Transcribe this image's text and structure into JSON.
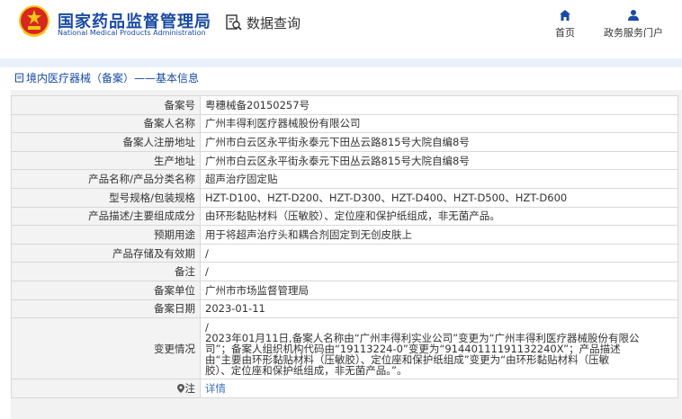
{
  "header": {
    "brand_cn": "国家药品监督管理局",
    "brand_en": "National Medical Products Administration",
    "data_query": "数据查询",
    "nav": [
      {
        "label": "首页",
        "icon": "home-icon"
      },
      {
        "label": "政务服务门户",
        "icon": "user-icon"
      }
    ]
  },
  "breadcrumb": "境内医疗器械（备案）——基本信息",
  "rows": [
    {
      "label": "备案号",
      "value": "粤穗械备20150257号"
    },
    {
      "label": "备案人名称",
      "value": "广州丰得利医疗器械股份有限公司"
    },
    {
      "label": "备案人注册地址",
      "value": "广州市白云区永平街永泰元下田丛云路815号大院自编8号"
    },
    {
      "label": "生产地址",
      "value": "广州市白云区永平街永泰元下田丛云路815号大院自编8号"
    },
    {
      "label": "产品名称/产品分类名称",
      "value": "超声治疗固定贴"
    },
    {
      "label": "型号规格/包装规格",
      "value": "HZT-D100、HZT-D200、HZT-D300、HZT-D400、HZT-D500、HZT-D600"
    },
    {
      "label": "产品描述/主要组成成分",
      "value": "由环形黏贴材料（压敏胶）、定位座和保护纸组成，非无菌产品。"
    },
    {
      "label": "预期用途",
      "value": "用于将超声治疗头和耦合剂固定到无创皮肤上"
    },
    {
      "label": "产品存储及有效期",
      "value": "/"
    },
    {
      "label": "备注",
      "value": "/"
    },
    {
      "label": "备案单位",
      "value": "广州市市场监督管理局"
    },
    {
      "label": "备案日期",
      "value": "2023-01-11"
    }
  ],
  "change": {
    "label": "变更情况",
    "lines": [
      "/",
      "2023年01月11日,备案人名称由“广州丰得利实业公司”变更为“广州丰得利医疗器械股份有限公",
      "司”；备案人组织机构代码由“19113224-0”变更为“91440111191132240X”；产品描述",
      "由“主要由环形黏贴材料（压敏胶）、定位座和保护纸组成”变更为“由环形黏贴材料（压敏",
      "胶）、定位座和保护纸组成，非无菌产品。”。"
    ]
  },
  "note": {
    "label": "注",
    "value": "详情"
  },
  "colors": {
    "brand_blue": "#1a4aa3",
    "link_blue": "#3a6fb8",
    "emblem_red": "#d6281f",
    "emblem_gold": "#f5c518"
  }
}
